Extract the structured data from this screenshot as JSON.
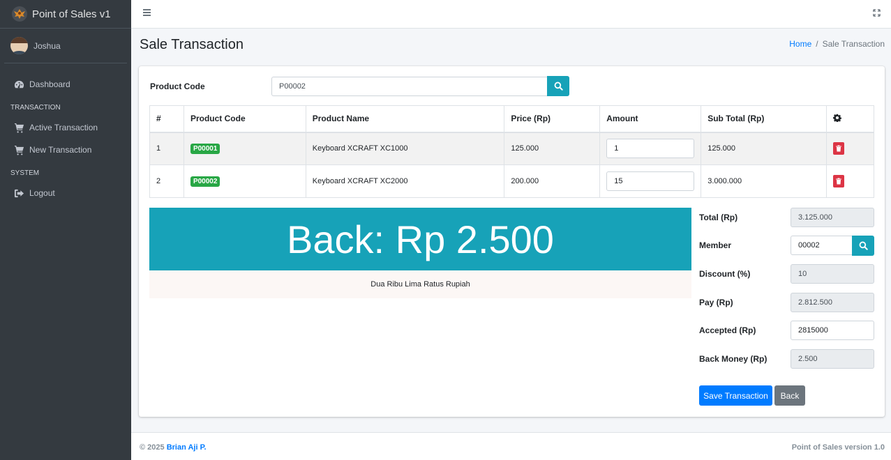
{
  "app": {
    "title": "Point of Sales v1"
  },
  "user": {
    "name": "Joshua"
  },
  "sidebar": {
    "items": [
      {
        "label": "Dashboard",
        "icon": "tachometer-icon"
      },
      {
        "header": "TRANSACTION"
      },
      {
        "label": "Active Transaction",
        "icon": "cart-icon"
      },
      {
        "label": "New Transaction",
        "icon": "cart-icon"
      },
      {
        "header": "SYSTEM"
      },
      {
        "label": "Logout",
        "icon": "sign-out-icon"
      }
    ]
  },
  "page": {
    "title": "Sale Transaction",
    "breadcrumb": {
      "home": "Home",
      "separator": "/",
      "current": "Sale Transaction"
    }
  },
  "product_search": {
    "label": "Product Code",
    "value": "P00002"
  },
  "table": {
    "headers": [
      "#",
      "Product Code",
      "Product Name",
      "Price (Rp)",
      "Amount",
      "Sub Total (Rp)"
    ],
    "rows": [
      {
        "no": "1",
        "code": "P00001",
        "name": "Keyboard XCRAFT XC1000",
        "price": "125.000",
        "amount": "1",
        "subtotal": "125.000"
      },
      {
        "no": "2",
        "code": "P00002",
        "name": "Keyboard XCRAFT XC2000",
        "price": "200.000",
        "amount": "15",
        "subtotal": "3.000.000"
      }
    ]
  },
  "summary": {
    "back_banner": "Back: Rp 2.500",
    "terbilang": "Dua Ribu Lima Ratus Rupiah",
    "total_label": "Total (Rp)",
    "total": "3.125.000",
    "member_label": "Member",
    "member": "00002",
    "discount_label": "Discount (%)",
    "discount": "10",
    "pay_label": "Pay (Rp)",
    "pay": "2.812.500",
    "accepted_label": "Accepted (Rp)",
    "accepted": "2815000",
    "back_money_label": "Back Money (Rp)",
    "back_money": "2.500"
  },
  "buttons": {
    "save": "Save Transaction",
    "back": "Back"
  },
  "footer": {
    "copyright": "© 2025 ",
    "author": "Brian Aji P.",
    "version": "Point of Sales version 1.0"
  },
  "colors": {
    "sidebar": "#343a40",
    "info": "#17a2b8",
    "primary": "#007bff",
    "success": "#28a745",
    "danger": "#dc3545",
    "secondary": "#6c757d"
  }
}
